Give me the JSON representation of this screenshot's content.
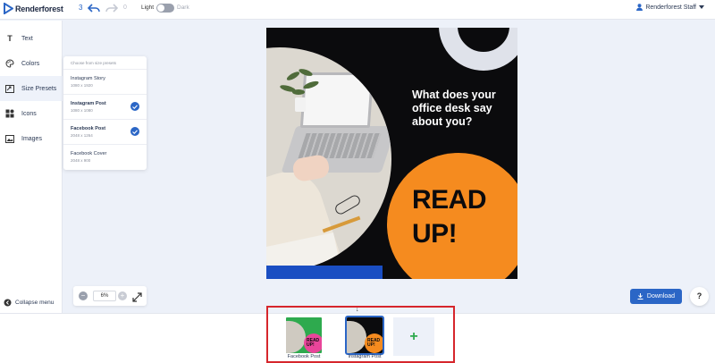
{
  "app": {
    "name": "Renderforest",
    "accent": "#2b66c6"
  },
  "toolbar": {
    "step_count": "3",
    "redo_count": "0",
    "theme_light": "Light",
    "theme_dark": "Dark",
    "theme_selected": "Light",
    "user": "Renderforest Staff"
  },
  "sidebar": {
    "items": [
      {
        "label": "Text",
        "icon": "text-icon"
      },
      {
        "label": "Colors",
        "icon": "palette-icon"
      },
      {
        "label": "Size Presets",
        "icon": "resize-icon",
        "active": true
      },
      {
        "label": "Icons",
        "icon": "shapes-icon"
      },
      {
        "label": "Images",
        "icon": "image-icon"
      }
    ],
    "collapse_label": "Collapse menu"
  },
  "presets": {
    "heading": "Choose from size presets",
    "items": [
      {
        "name": "Instagram Story",
        "size": "1080 x 1920",
        "checked": false
      },
      {
        "name": "Instagram Post",
        "size": "1080 x 1080",
        "checked": true
      },
      {
        "name": "Facebook Post",
        "size": "2048 x 1264",
        "checked": true
      },
      {
        "name": "Facebook Cover",
        "size": "2048 x 900",
        "checked": false
      }
    ]
  },
  "artwork": {
    "headline": "What does your office desk say about you?",
    "cta_line1": "READ",
    "cta_line2": "UP!"
  },
  "zoom": {
    "value": "6%"
  },
  "actions": {
    "download_label": "Download",
    "help_label": "?"
  },
  "bottom": {
    "thumbnails": [
      {
        "label": "Facebook Post",
        "text1": "READ",
        "text2": "UP!"
      },
      {
        "label": "Instagram Post",
        "text1": "READ",
        "text2": "UP!"
      }
    ],
    "add_label": "+"
  }
}
